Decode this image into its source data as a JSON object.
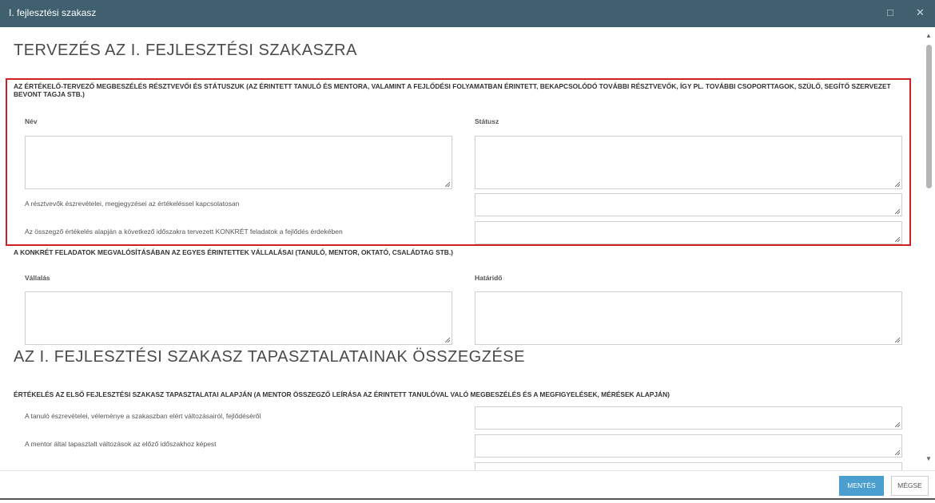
{
  "window": {
    "title": "I. fejlesztési szakasz",
    "maximize_icon": "□",
    "close_icon": "✕"
  },
  "planning": {
    "heading": "TERVEZÉS AZ I. FEJLESZTÉSI SZAKASZRA",
    "participants_section": "AZ ÉRTÉKELŐ-TERVEZŐ MEGBESZÉLÉS RÉSZTVEVŐI ÉS STÁTUSZUK (AZ ÉRINTETT TANULÓ ÉS MENTORA, VALAMINT A FEJLŐDÉSI FOLYAMATBAN ÉRINTETT, BEKAPCSOLÓDÓ TOVÁBBI RÉSZTVEVŐK, ÍGY PL. TOVÁBBI CSOPORTTAGOK, SZÜLŐ, SEGÍTŐ SZERVEZET BEVONT TAGJA STB.)",
    "name_label": "Név",
    "status_label": "Státusz",
    "observations_label": "A résztvevők észrevételei, megjegyzései az értékeléssel kapcsolatosan",
    "tasks_label": "Az összegző értékelés alapján a következő időszakra tervezett KONKRÉT feladatok a fejlődés érdekében",
    "commitments_section": "A KONKRÉT FELADATOK MEGVALÓSÍTÁSÁBAN AZ EGYES ÉRINTETTEK VÁLLALÁSAI (TANULÓ, MENTOR, OKTATÓ, CSALÁDTAG STB.)",
    "commitment_label": "Vállalás",
    "deadline_label": "Határidő"
  },
  "summary": {
    "heading": "AZ I. FEJLESZTÉSI SZAKASZ TAPASZTALATAINAK ÖSSZEGZÉSE",
    "evaluation_section": "ÉRTÉKELÉS AZ ELSŐ FEJLESZTÉSI SZAKASZ TAPASZTALATAI ALAPJÁN (A MENTOR ÖSSZEGZŐ LEÍRÁSA AZ ÉRINTETT TANULÓVAL VALÓ MEGBESZÉLÉS ÉS A MEGFIGYELÉSEK, MÉRÉSEK ALAPJÁN)",
    "student_obs_label": "A tanuló észrevételei, véleménye a szakaszban elért változásairól, fejlődéséről",
    "mentor_obs_label": "A mentor által tapasztalt változások az előző időszakhoz képest"
  },
  "footer": {
    "save_label": "MENTÉS",
    "cancel_label": "MÉGSE"
  },
  "colors": {
    "titlebar": "#40606f",
    "accent": "#4a9fd0",
    "highlight": "#cc2222"
  }
}
